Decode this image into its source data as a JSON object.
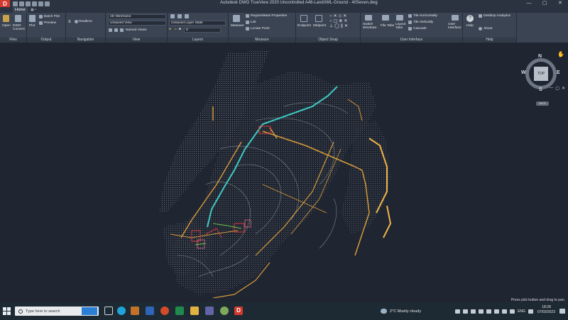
{
  "window": {
    "app_logo": "D",
    "title": "Autodesk DWG TrueView 2020   Uncontrolled A46-LandXML-Ground - 40Seven.dwg",
    "controls": [
      "—",
      "▢",
      "✕"
    ]
  },
  "tabs": {
    "home": "Home",
    "extra": "▣ •"
  },
  "ribbon": {
    "files": {
      "title": "Files",
      "open": "Open",
      "dwg_convert": "DWG\nConvert"
    },
    "output": {
      "title": "Output",
      "plot": "Plot",
      "batch_plot": "Batch Plot",
      "preview": "Preview"
    },
    "navigation": {
      "title": "Navigation",
      "realtime": "Realtime"
    },
    "view": {
      "title": "View",
      "visual_style": "2D Wireframe",
      "saved_view": "Unsaved View",
      "named_views": "Named Views"
    },
    "layers": {
      "title": "Layers",
      "layer_state": "Unsaved Layer State",
      "current_layer": "0"
    },
    "measure": {
      "title": "Measure",
      "measure": "Measure",
      "region_mass": "Region/Mass Properties",
      "list": "List",
      "locate_point": "Locate Point"
    },
    "object_snap": {
      "title": "Object Snap",
      "endpoint": "Endpoint",
      "midpoint": "Midpoint"
    },
    "user_interface": {
      "title": "User Interface",
      "switch_windows": "Switch\nWindows",
      "file_tabs": "File Tabs",
      "layout_tabs": "Layout\nTabs",
      "tile_h": "Tile Horizontally",
      "tile_v": "Tile Vertically",
      "cascade": "Cascade",
      "user_interface": "User\nInterface"
    },
    "help": {
      "title": "Help",
      "help": "Help",
      "desktop_analytics": "Desktop Analytics",
      "about": "About"
    }
  },
  "viewcube": {
    "north": "N",
    "south": "S",
    "east": "E",
    "west": "W",
    "top": "TOP",
    "wcs": "WCS"
  },
  "canvas_ctrls": [
    "—",
    "▢",
    "✕"
  ],
  "status": {
    "message": "Press pick button and drag to pan."
  },
  "taskbar": {
    "search_placeholder": "Type here to search",
    "weather": "2°C  Mostly cloudy",
    "language": "ENG",
    "time": "18:28",
    "date": "07/03/2023"
  },
  "colors": {
    "canvas_bg": "#1f2631",
    "contour": "#8a8f96",
    "road": "#d79a3a",
    "road_bright": "#f0b348",
    "water": "#3fc9c3",
    "red": "#d63a3a",
    "green": "#6fbf4a",
    "pink": "#d76a8a"
  }
}
